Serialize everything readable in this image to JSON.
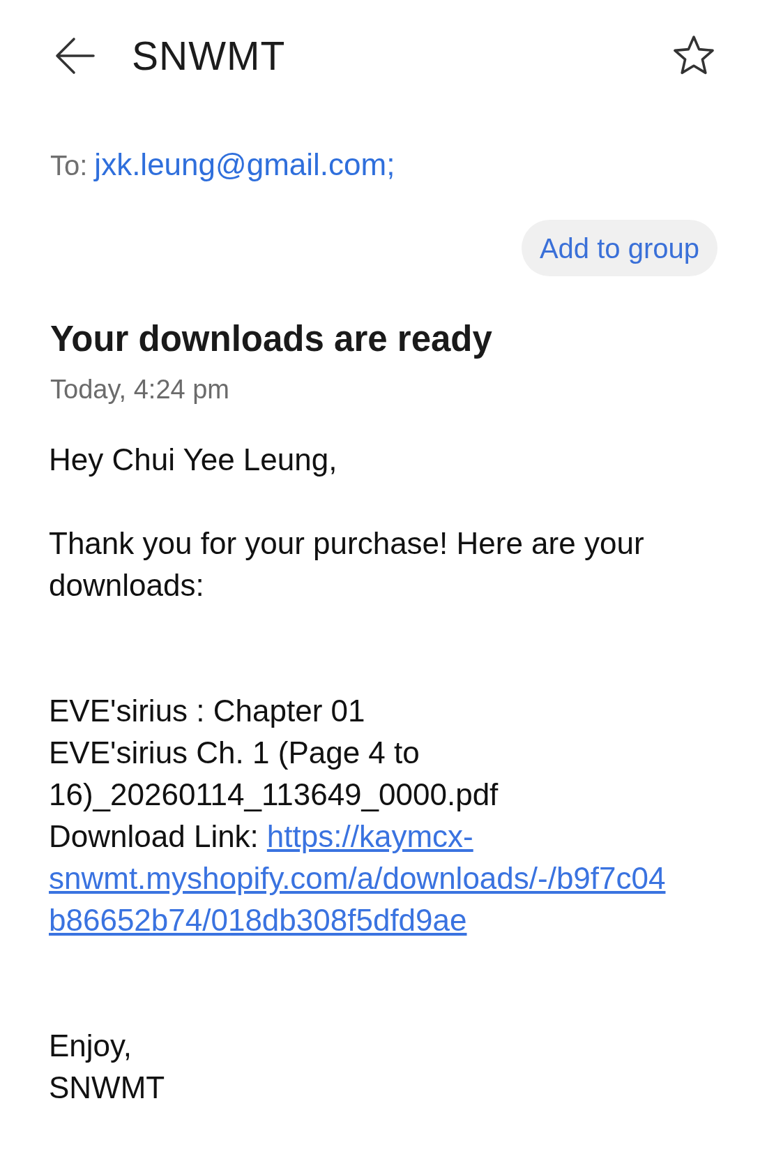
{
  "header": {
    "title": "SNWMT",
    "starred": false
  },
  "recipients": {
    "label": "To:",
    "addresses": [
      "jxk.leung@gmail.com;"
    ]
  },
  "add_to_group_button": "Add to group",
  "subject": "Your downloads are ready",
  "date": "Today, 4:24 pm",
  "message": {
    "greeting": "Hey Chui Yee Leung,",
    "intro": "Thank you for your purchase! Here are your downloads:",
    "downloads": [
      {
        "product": "EVE'sirius : Chapter 01",
        "file": "EVE'sirius Ch. 1 (Page 4 to 16)_20260114_113649_0000.pdf",
        "link_label": "Download Link:",
        "link_lines": [
          "https://kaymcx-",
          "snwmt.myshopify.com/a/downloads/-/b9f7c04",
          "b86652b74/018db308f5dfd9ae"
        ]
      }
    ],
    "sign_off": [
      "Enjoy,",
      "SNWMT"
    ]
  }
}
